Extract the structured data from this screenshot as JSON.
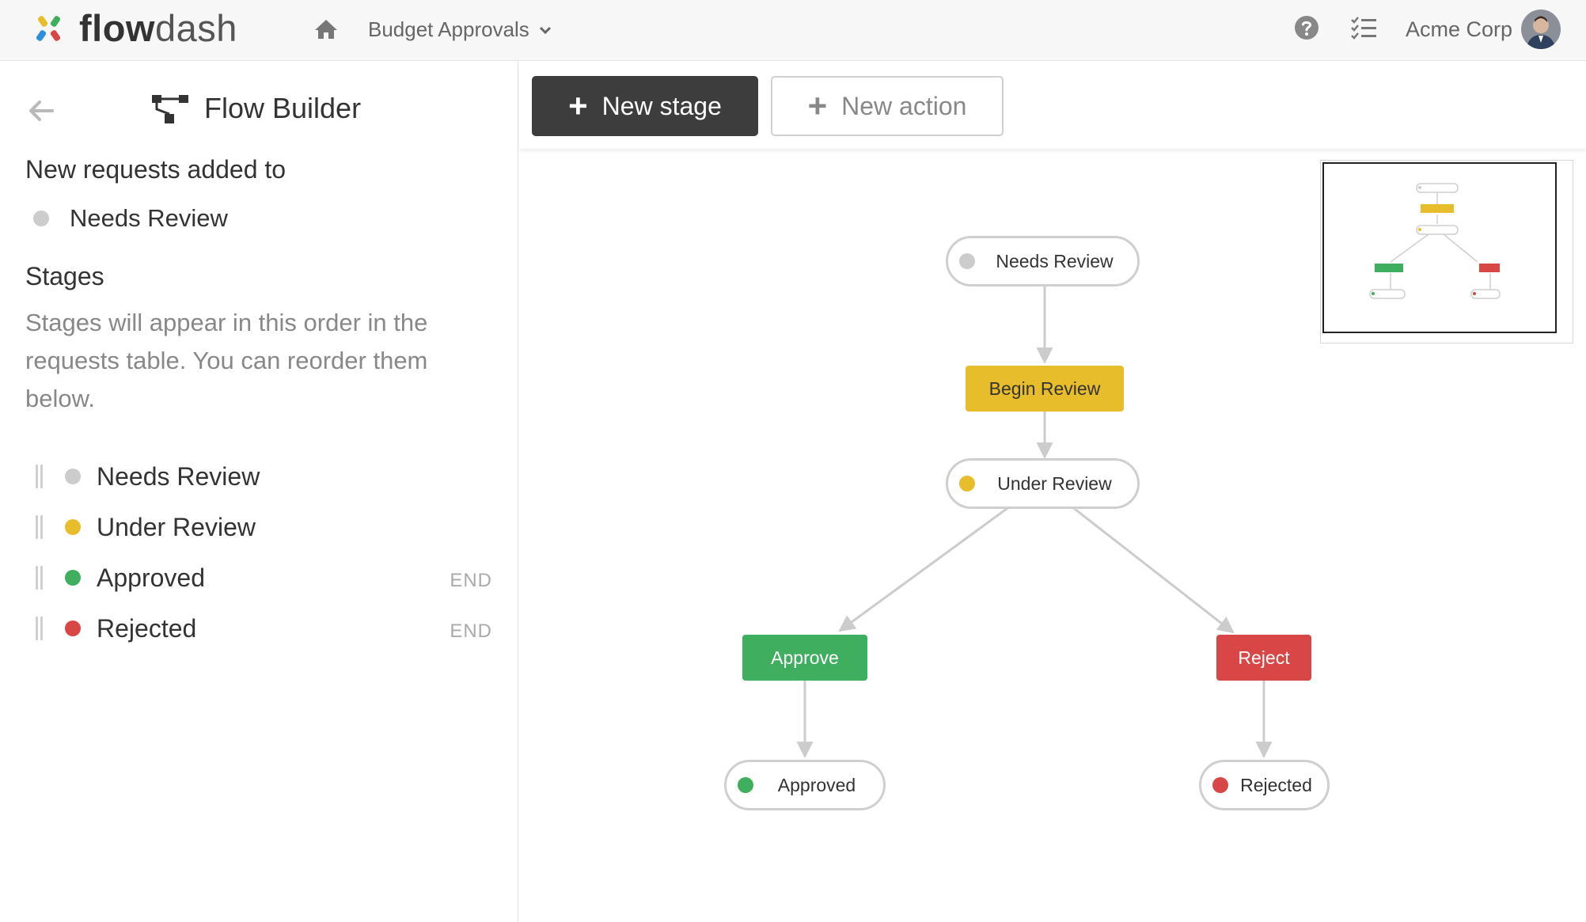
{
  "header": {
    "logo_primary": "flow",
    "logo_secondary": "dash",
    "app_name": "Budget Approvals",
    "org_name": "Acme Corp"
  },
  "sidebar": {
    "title": "Flow Builder",
    "new_requests_heading": "New requests added to",
    "initial_stage": {
      "name": "Needs Review",
      "color": "#cccccc"
    },
    "stages_heading": "Stages",
    "stages_description": "Stages will appear in this order in the requests table. You can reorder them below.",
    "stages": [
      {
        "name": "Needs Review",
        "color": "#cccccc",
        "end_label": ""
      },
      {
        "name": "Under Review",
        "color": "#e8bd2b",
        "end_label": ""
      },
      {
        "name": "Approved",
        "color": "#3fae5f",
        "end_label": "END"
      },
      {
        "name": "Rejected",
        "color": "#d84646",
        "end_label": "END"
      }
    ]
  },
  "toolbar": {
    "new_stage_label": "New stage",
    "new_action_label": "New action"
  },
  "flow": {
    "nodes": {
      "needs_review": {
        "label": "Needs Review",
        "kind": "stage",
        "color": "#cccccc"
      },
      "begin_review": {
        "label": "Begin Review",
        "kind": "action",
        "color": "#e8bd2b"
      },
      "under_review": {
        "label": "Under Review",
        "kind": "stage",
        "color": "#e8bd2b"
      },
      "approve": {
        "label": "Approve",
        "kind": "action",
        "color": "#3fae5f"
      },
      "reject": {
        "label": "Reject",
        "kind": "action",
        "color": "#d84646"
      },
      "approved": {
        "label": "Approved",
        "kind": "stage",
        "color": "#3fae5f"
      },
      "rejected": {
        "label": "Rejected",
        "kind": "stage",
        "color": "#d84646"
      }
    },
    "edges": [
      [
        "needs_review",
        "begin_review"
      ],
      [
        "begin_review",
        "under_review"
      ],
      [
        "under_review",
        "approve"
      ],
      [
        "under_review",
        "reject"
      ],
      [
        "approve",
        "approved"
      ],
      [
        "reject",
        "rejected"
      ]
    ]
  },
  "icons": {
    "home": "home-icon",
    "app_dropdown": "chevron-down-icon",
    "help": "question-circle-icon",
    "tasks": "checklist-icon",
    "back": "arrow-left-icon",
    "flow_builder": "flow-diagram-icon",
    "add": "plus-icon",
    "drag": "drag-handle-icon"
  }
}
